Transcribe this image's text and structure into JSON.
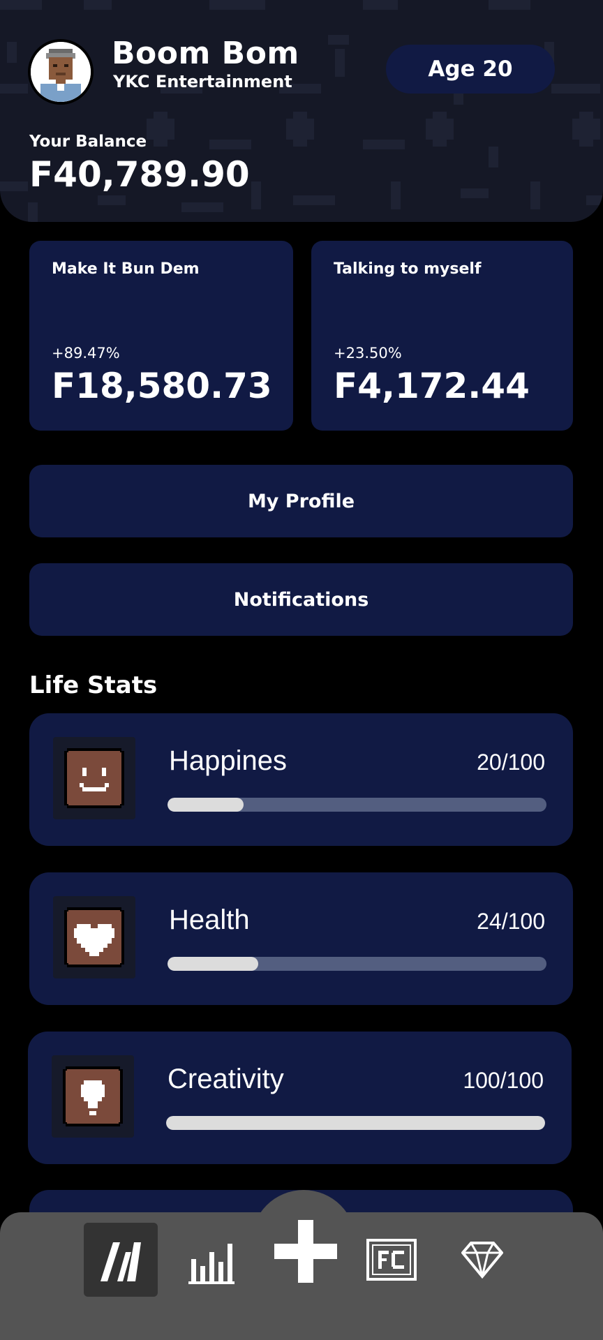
{
  "header": {
    "player_name": "Boom Bom",
    "company": "YKC Entertainment",
    "age_label": "Age 20",
    "balance_label": "Your Balance",
    "balance_value": "F40,789.90"
  },
  "songs": [
    {
      "title": "Make It Bun Dem",
      "change": "+89.47%",
      "earnings": "F18,580.73"
    },
    {
      "title": "Talking to myself",
      "change": "+23.50%",
      "earnings": "F4,172.44"
    }
  ],
  "menu": {
    "profile_label": "My Profile",
    "notifications_label": "Notifications"
  },
  "life_stats": {
    "title": "Life Stats",
    "items": [
      {
        "label": "Happines",
        "value": "20/100",
        "fraction": 0.2,
        "icon": "smiley-icon"
      },
      {
        "label": "Health",
        "value": "24/100",
        "fraction": 0.24,
        "icon": "heart-icon"
      },
      {
        "label": "Creativity",
        "value": "100/100",
        "fraction": 1.0,
        "icon": "lightbulb-icon"
      }
    ]
  },
  "nav": {
    "items": [
      "stocks-icon",
      "chart-icon",
      "plus-icon",
      "fc-icon",
      "diamond-icon"
    ],
    "active": "stocks-icon"
  },
  "colors": {
    "card": "#111a44",
    "header_bg": "#151826",
    "nav_bg": "#545454",
    "icon_brown": "#7b4a3b",
    "bar_fill": "#dcdcdc",
    "bar_track": "#535e80"
  }
}
